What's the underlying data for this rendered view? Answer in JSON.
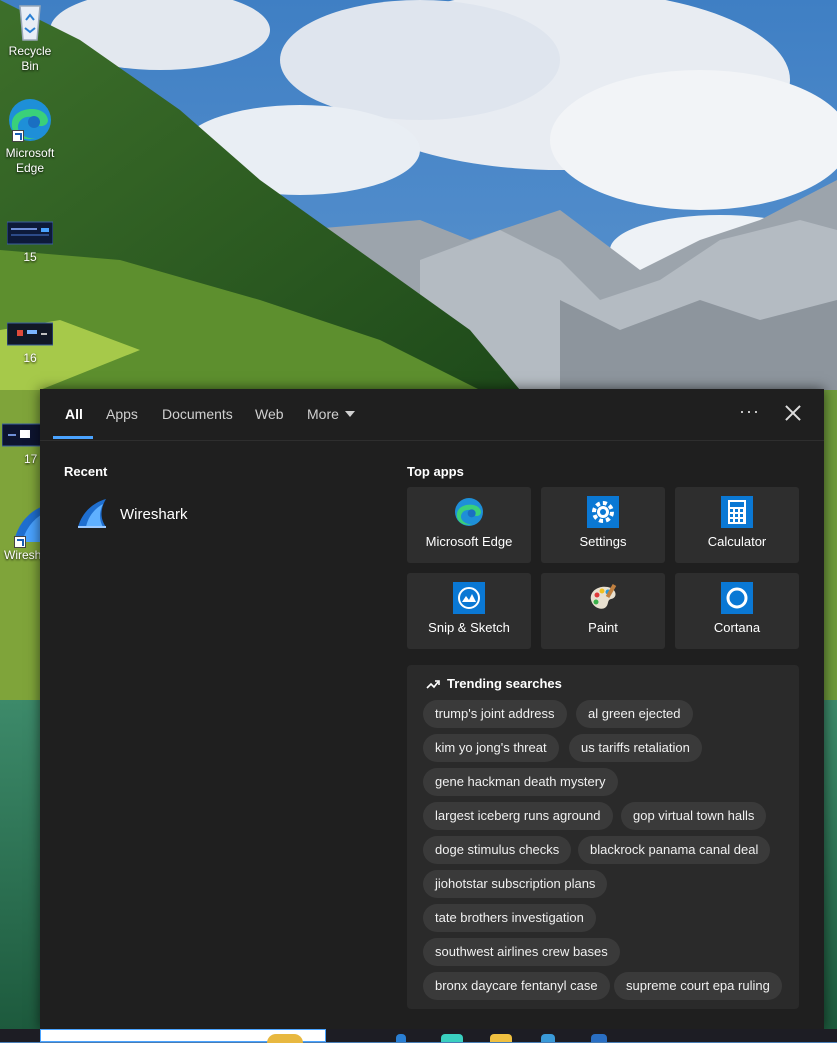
{
  "desktop": {
    "icons": [
      {
        "label": "Recycle Bin",
        "icon": "recycle-bin-icon"
      },
      {
        "label": "Microsoft\nEdge",
        "icon": "edge-icon"
      },
      {
        "label": "15",
        "icon": "screenshot-thumbnail-icon"
      },
      {
        "label": "16",
        "icon": "screenshot-thumbnail-icon"
      },
      {
        "label": "17",
        "icon": "screenshot-thumbnail-icon"
      },
      {
        "label": "Wiresh",
        "icon": "wireshark-icon"
      }
    ]
  },
  "search_panel": {
    "tabs": [
      {
        "label": "All",
        "active": true
      },
      {
        "label": "Apps"
      },
      {
        "label": "Documents"
      },
      {
        "label": "Web"
      },
      {
        "label": "More"
      }
    ],
    "options_glyph": "···",
    "recent": {
      "title": "Recent",
      "items": [
        {
          "label": "Wireshark",
          "icon": "wireshark-icon"
        }
      ]
    },
    "top_apps": {
      "title": "Top apps",
      "items": [
        {
          "label": "Microsoft Edge",
          "icon": "edge-icon"
        },
        {
          "label": "Settings",
          "icon": "gear-icon"
        },
        {
          "label": "Calculator",
          "icon": "calculator-icon"
        },
        {
          "label": "Snip & Sketch",
          "icon": "snip-sketch-icon"
        },
        {
          "label": "Paint",
          "icon": "paint-palette-icon"
        },
        {
          "label": "Cortana",
          "icon": "cortana-icon"
        }
      ]
    },
    "trending": {
      "title": "Trending searches",
      "chips": [
        "trump's joint address",
        "al green ejected",
        "kim yo jong's threat",
        "us tariffs retaliation",
        "gene hackman death mystery",
        "largest iceberg runs aground",
        "gop virtual town halls",
        "doge stimulus checks",
        "blackrock panama canal deal",
        "jiohotstar subscription plans",
        "tate brothers investigation",
        "southwest airlines crew bases",
        "bronx daycare fentanyl case",
        "supreme court epa ruling"
      ]
    }
  },
  "colors": {
    "panel_bg": "#1f1f1f",
    "tile_bg": "#2e2e2e",
    "chip_bg": "#3a3a3a",
    "accent": "#4aa3ff"
  }
}
